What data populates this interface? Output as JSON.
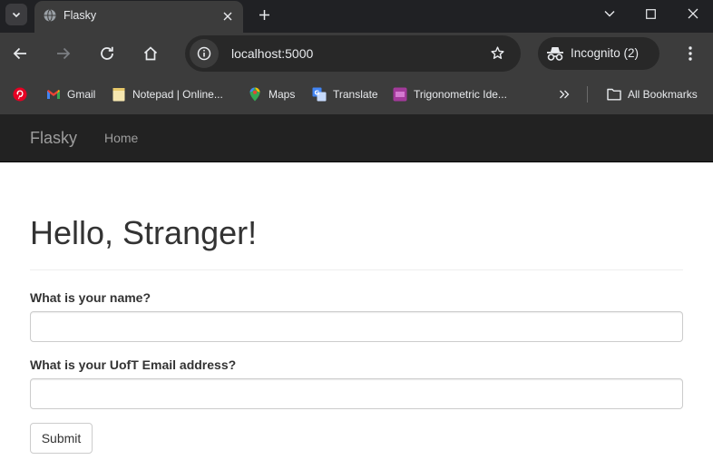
{
  "browser": {
    "tab_title": "Flasky",
    "url": "localhost:5000",
    "incognito_label": "Incognito (2)",
    "bookmarks": [
      {
        "label": "",
        "icon": "pinterest-icon"
      },
      {
        "label": "Gmail",
        "icon": "gmail-icon"
      },
      {
        "label": "Notepad | Online...",
        "icon": "notepad-icon"
      },
      {
        "label": "Maps",
        "icon": "maps-icon"
      },
      {
        "label": "Translate",
        "icon": "translate-icon"
      },
      {
        "label": "Trigonometric Ide...",
        "icon": "trig-icon"
      }
    ],
    "all_bookmarks_label": "All Bookmarks",
    "colors": {
      "tabstrip": "#202124",
      "toolbar": "#3c3c3c",
      "omnibox": "#282828"
    }
  },
  "navbar": {
    "brand": "Flasky",
    "links": [
      {
        "label": "Home"
      }
    ],
    "color": "#222222"
  },
  "page": {
    "heading": "Hello, Stranger!",
    "form": {
      "name_label": "What is your name?",
      "name_value": "",
      "email_label": "What is your UofT Email address?",
      "email_value": "",
      "submit_label": "Submit"
    }
  }
}
